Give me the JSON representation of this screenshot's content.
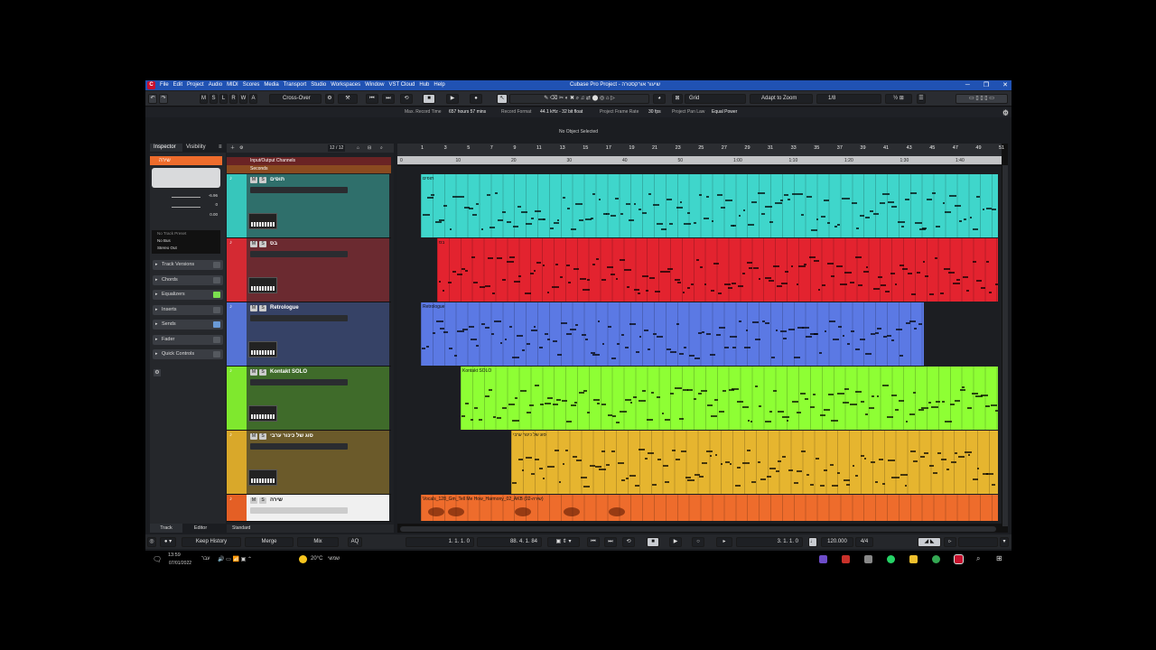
{
  "window": {
    "title": "Cubase Pro Project - שיעור אורקסטרה",
    "minimize": "─",
    "maximize": "❐",
    "close": "✕",
    "logo": "C"
  },
  "menu": [
    "File",
    "Edit",
    "Project",
    "Audio",
    "MIDI",
    "Scores",
    "Media",
    "Transport",
    "Studio",
    "Workspaces",
    "Window",
    "VST Cloud",
    "Hub",
    "Help"
  ],
  "toolbar": {
    "mode_m": "M",
    "mode_s": "S",
    "mode_l": "L",
    "mode_r": "R",
    "mode_w": "W",
    "mode_a": "A",
    "crossover": "Cross-Over",
    "grid": "Grid",
    "adapt": "Adapt to Zoom",
    "quantize": "1/8"
  },
  "infoline": {
    "max_record_label": "Max. Record Time",
    "max_record_value": "657 hours 57 mins",
    "record_format_label": "Record Format",
    "record_format_value": "44.1 kHz - 32 bit float",
    "frame_rate_label": "Project Frame Rate",
    "frame_rate_value": "30 fps",
    "pan_law_label": "Project Pan Law",
    "pan_law_value": "Equal Power"
  },
  "object_line": "No Object Selected",
  "inspector": {
    "tab_inspector": "Inspector",
    "tab_visibility": "Visibility",
    "track_name": "שירה",
    "volume": "-6.96",
    "pan": "0",
    "delay": "0.00",
    "track_preset": "No Track Preset",
    "input": "No Bus",
    "output": "Stereo Out",
    "sections": [
      "Track Versions",
      "Chords",
      "Equalizers",
      "Inserts",
      "Sends",
      "Fader",
      "Quick Controls"
    ],
    "bottom_tab_track": "Track",
    "bottom_tab_editor": "Editor"
  },
  "trackhead": {
    "count": "12 / 12",
    "folder": "Input/Output Channels",
    "ruler_label": "Seconds",
    "footer": "Standard"
  },
  "tracks": [
    {
      "name": "תופים",
      "part": "תופים",
      "color": "#3fd6cb",
      "strip": "#37c6bb",
      "body": "#2f6f6b"
    },
    {
      "name": "בס",
      "part": "בס",
      "color": "#e3232f",
      "strip": "#d42a33",
      "body": "#6b2a30"
    },
    {
      "name": "Retrologue",
      "part": "Retrologue",
      "color": "#5b79e4",
      "strip": "#5573d6",
      "body": "#364266"
    },
    {
      "name": "Kontakt SOLO",
      "part": "Kontakt SOLO",
      "color": "#8eff34",
      "strip": "#7fe82e",
      "body": "#3f6b2a"
    },
    {
      "name": "סוג של כינור ערבי",
      "part": "סוג של כינור ערבי",
      "color": "#e6b52f",
      "strip": "#d9a82a",
      "body": "#6b5a2a"
    },
    {
      "name": "שירה",
      "part": "Vocals_128_Gm_Tell Me How_Harmony_02_AKB (02-שירה)",
      "color": "#ee6c2c",
      "strip": "#e45f25",
      "body": "#f0f0f0"
    }
  ],
  "ruler": {
    "bars": [
      "1",
      "3",
      "5",
      "7",
      "9",
      "11",
      "13",
      "15",
      "17",
      "19",
      "21",
      "23",
      "25",
      "27",
      "29",
      "31",
      "33",
      "35",
      "37",
      "39",
      "41",
      "43",
      "45",
      "47",
      "49",
      "51"
    ],
    "seconds": [
      "0",
      "10",
      "20",
      "30",
      "40",
      "50",
      "1:00",
      "1:10",
      "1:20",
      "1:30",
      "1:40"
    ]
  },
  "transport": {
    "history": "Keep History",
    "merge": "Merge",
    "mix": "Mix",
    "left_locator": "1. 1. 1. 0",
    "right_locator": "88. 4. 1. 84",
    "position": "3. 1. 1. 0",
    "tempo": "120.000",
    "signature": "4/4"
  },
  "taskbar": {
    "time": "13:59",
    "date": "07/01/2022",
    "lang": "עבר",
    "weather": "20°C",
    "weather_text": "שמשי"
  }
}
